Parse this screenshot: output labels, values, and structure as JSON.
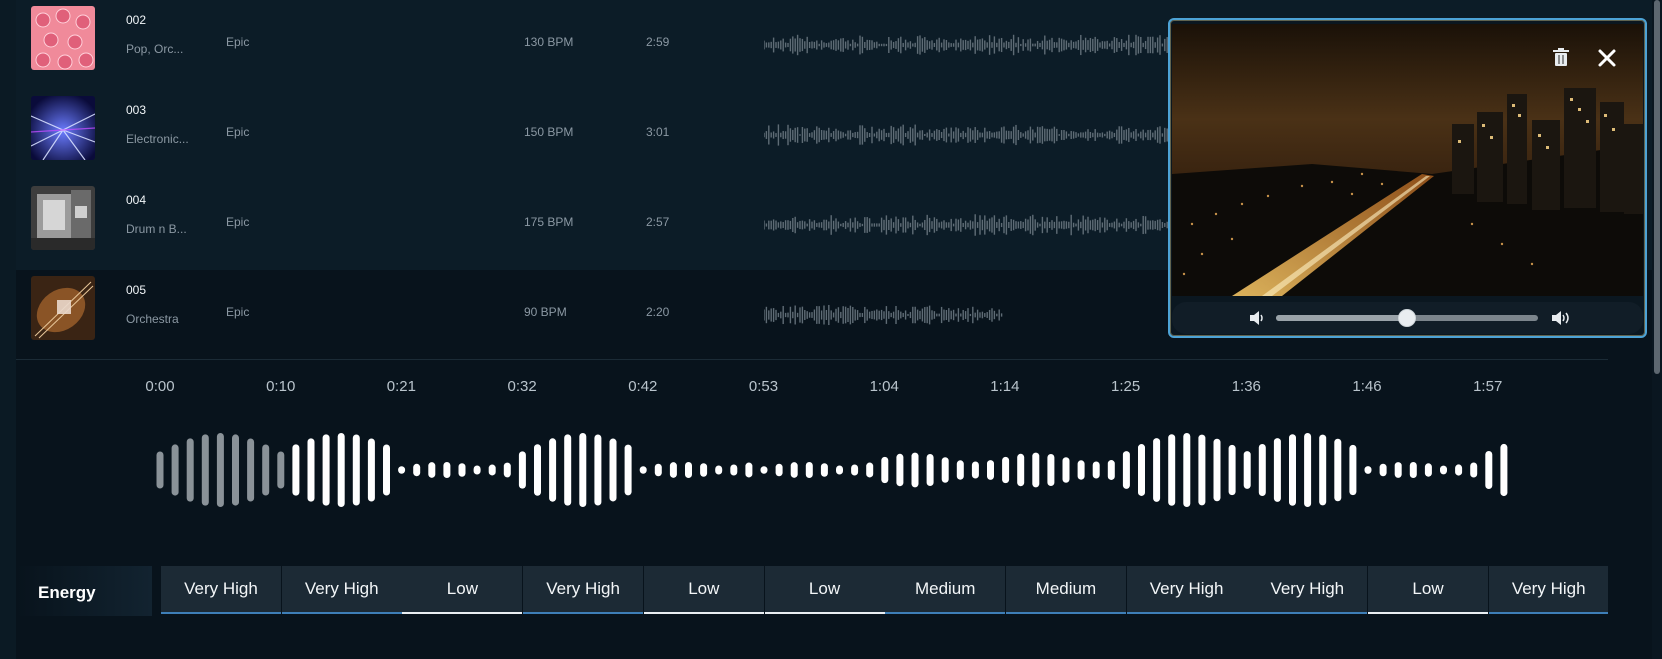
{
  "tracks": [
    {
      "number": "002",
      "genre": "Pop, Orc...",
      "mood": "Epic",
      "bpm": "130 BPM",
      "duration": "2:59",
      "art": "pink-vinyl"
    },
    {
      "number": "003",
      "genre": "Electronic...",
      "mood": "Epic",
      "bpm": "150 BPM",
      "duration": "3:01",
      "art": "laser-lights"
    },
    {
      "number": "004",
      "genre": "Drum n B...",
      "mood": "Epic",
      "bpm": "175 BPM",
      "duration": "2:57",
      "art": "monochrome-machine"
    },
    {
      "number": "005",
      "genre": "Orchestra",
      "mood": "Epic",
      "bpm": "90 BPM",
      "duration": "2:20",
      "art": "violin"
    }
  ],
  "timeline": {
    "ticks": [
      "0:00",
      "0:10",
      "0:21",
      "0:32",
      "0:42",
      "0:53",
      "1:04",
      "1:14",
      "1:25",
      "1:36",
      "1:46",
      "1:57"
    ],
    "playback_progress": 0.09
  },
  "energy": {
    "label": "Energy",
    "values": [
      "Very High",
      "Very High",
      "Low",
      "Very High",
      "Low",
      "Low",
      "Medium",
      "Medium",
      "Very High",
      "Very High",
      "Low",
      "Very High"
    ]
  },
  "video_player": {
    "volume": 0.5,
    "icons": {
      "delete": "trash-icon",
      "close": "close-icon",
      "mute": "volume-low-icon",
      "max": "volume-high-icon"
    }
  },
  "colors": {
    "background": "#08131c",
    "row": "#0c1c27",
    "accent": "#4da3d6",
    "chip": "#1c2a35"
  }
}
